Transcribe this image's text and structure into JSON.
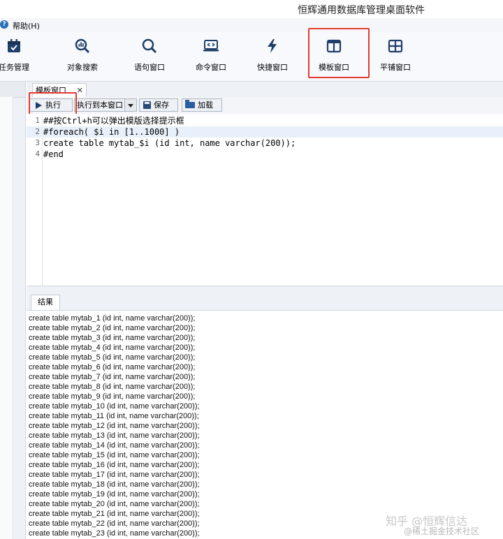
{
  "window": {
    "title": "恒辉通用数据库管理桌面软件"
  },
  "menu": {
    "help_label": "帮助(H)",
    "help_icon": "?"
  },
  "toolbar": {
    "items": [
      {
        "label": "任务管理",
        "icon": "calendar-icon"
      },
      {
        "label": "对象搜索",
        "icon": "magnifier-chart-icon"
      },
      {
        "label": "语句窗口",
        "icon": "search-icon"
      },
      {
        "label": "命令窗口",
        "icon": "laptop-code-icon"
      },
      {
        "label": "快捷窗口",
        "icon": "lightning-icon"
      },
      {
        "label": "模板窗口",
        "icon": "columns-icon"
      },
      {
        "label": "平铺窗口",
        "icon": "grid-icon"
      }
    ],
    "highlight_color": "#e33b2f"
  },
  "editor": {
    "tab_label": "模板窗口",
    "tab_close": "✕",
    "run_label": "执行",
    "run_to_label": "执行到本窗口",
    "save_label": "保存",
    "load_label": "加载",
    "lines": [
      {
        "no": "1",
        "text": "##按Ctrl+h可以弹出模版选择提示框"
      },
      {
        "no": "2",
        "text": "#foreach( $i in [1..1000] )"
      },
      {
        "no": "3",
        "text": "create table mytab_$i (id int, name varchar(200));"
      },
      {
        "no": "4",
        "text": "#end"
      }
    ]
  },
  "results": {
    "tab_label": "结果",
    "rows": [
      "create table mytab_1 (id int, name varchar(200));",
      "create table mytab_2 (id int, name varchar(200));",
      "create table mytab_3 (id int, name varchar(200));",
      "create table mytab_4 (id int, name varchar(200));",
      "create table mytab_5 (id int, name varchar(200));",
      "create table mytab_6 (id int, name varchar(200));",
      "create table mytab_7 (id int, name varchar(200));",
      "create table mytab_8 (id int, name varchar(200));",
      "create table mytab_9 (id int, name varchar(200));",
      "create table mytab_10 (id int, name varchar(200));",
      "create table mytab_11 (id int, name varchar(200));",
      "create table mytab_12 (id int, name varchar(200));",
      "create table mytab_13 (id int, name varchar(200));",
      "create table mytab_14 (id int, name varchar(200));",
      "create table mytab_15 (id int, name varchar(200));",
      "create table mytab_16 (id int, name varchar(200));",
      "create table mytab_17 (id int, name varchar(200));",
      "create table mytab_18 (id int, name varchar(200));",
      "create table mytab_19 (id int, name varchar(200));",
      "create table mytab_20 (id int, name varchar(200));",
      "create table mytab_21 (id int, name varchar(200));",
      "create table mytab_22 (id int, name varchar(200));",
      "create table mytab_23 (id int, name varchar(200));"
    ]
  },
  "watermark": {
    "line1": "知乎 @恒辉信达",
    "line2": "@稀土掘金技术社区"
  }
}
